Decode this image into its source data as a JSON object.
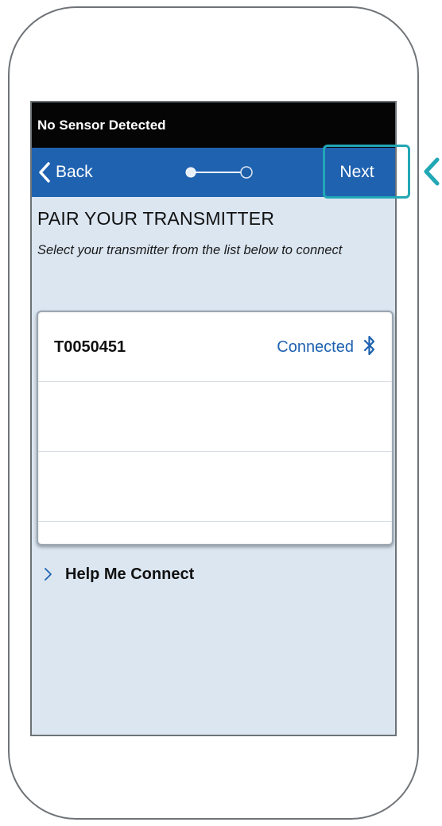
{
  "status_bar": {
    "text": "No Sensor Detected"
  },
  "nav": {
    "back_label": "Back",
    "next_label": "Next",
    "page_indicator": {
      "total_pages": 2,
      "current_page": 2
    }
  },
  "content": {
    "title": "PAIR YOUR TRANSMITTER",
    "subtitle": "Select your transmitter from the list below to connect"
  },
  "transmitter_list": [
    {
      "name": "T0050451",
      "status": "Connected",
      "icon": "bluetooth-icon"
    },
    {
      "name": "",
      "status": ""
    },
    {
      "name": "",
      "status": ""
    }
  ],
  "help": {
    "label": "Help Me Connect"
  },
  "colors": {
    "nav_bar": "#1f62b0",
    "status_bar": "#050505",
    "screen_background": "#dbe6f1",
    "callout": "#22a7b5",
    "link_blue": "#1f62b0"
  }
}
